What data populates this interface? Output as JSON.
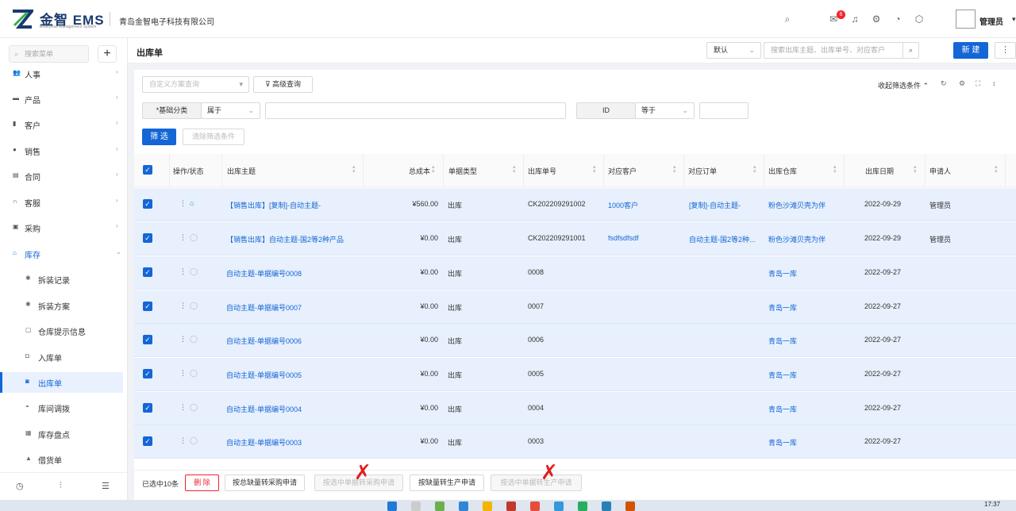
{
  "header": {
    "logo_text": "金智 EMS",
    "logo_sub": "Enterprise Management System",
    "company": "青岛金智电子科技有限公司",
    "badge_count": "6",
    "user_name": "管理员"
  },
  "sidebar": {
    "search_placeholder": "搜索菜单",
    "plus": "+",
    "items": [
      {
        "label": "人事",
        "icon": "people-icon"
      },
      {
        "label": "产品",
        "icon": "product-icon"
      },
      {
        "label": "客户",
        "icon": "customer-icon"
      },
      {
        "label": "销售",
        "icon": "sales-icon"
      },
      {
        "label": "合同",
        "icon": "contract-icon"
      },
      {
        "label": "客服",
        "icon": "headset-icon"
      },
      {
        "label": "采购",
        "icon": "purchase-icon"
      },
      {
        "label": "库存",
        "icon": "warehouse-icon"
      }
    ],
    "sub_items": [
      {
        "label": "拆装记录"
      },
      {
        "label": "拆装方案"
      },
      {
        "label": "仓库提示信息"
      },
      {
        "label": "入库单"
      },
      {
        "label": "出库单"
      },
      {
        "label": "库间调拨"
      },
      {
        "label": "库存盘点"
      },
      {
        "label": "借货单"
      }
    ]
  },
  "page": {
    "title": "出库单",
    "view_select": "默认",
    "search_placeholder": "搜索出库主题、出库单号、对应客户",
    "new_label": "新 建"
  },
  "filters": {
    "custom_placeholder": "自定义方案查询",
    "advanced_label": "高级查询",
    "collapse_label": "收起筛选条件",
    "field1_label": "*基础分类",
    "field1_op": "属于",
    "field2_label": "ID",
    "field2_op": "等于",
    "filter_btn": "筛 选",
    "clear_btn": "清除筛选条件"
  },
  "table": {
    "columns": [
      "操作/状态",
      "出库主题",
      "总成本",
      "单据类型",
      "出库单号",
      "对应客户",
      "对应订单",
      "出库仓库",
      "出库日期",
      "申请人"
    ],
    "rows": [
      {
        "subject": "【销售出库】[复制]-自动主题-",
        "cost": "¥560.00",
        "type": "出库",
        "number": "CK202209291002",
        "customer": "1000客户",
        "order": "[复制]-自动主题-",
        "warehouse": "粉色沙滩贝壳为伴",
        "date": "2022-09-29",
        "applicant": "管理员"
      },
      {
        "subject": "【销售出库】自动主题-国2等2种产品",
        "cost": "¥0.00",
        "type": "出库",
        "number": "CK202209291001",
        "customer": "fsdfsdfsdf",
        "order": "自动主题-国2等2种...",
        "warehouse": "粉色沙滩贝壳为伴",
        "date": "2022-09-29",
        "applicant": "管理员"
      },
      {
        "subject": "自动主题-单据编号0008",
        "cost": "¥0.00",
        "type": "出库",
        "number": "0008",
        "customer": "",
        "order": "",
        "warehouse": "青岛一库",
        "date": "2022-09-27",
        "applicant": ""
      },
      {
        "subject": "自动主题-单据编号0007",
        "cost": "¥0.00",
        "type": "出库",
        "number": "0007",
        "customer": "",
        "order": "",
        "warehouse": "青岛一库",
        "date": "2022-09-27",
        "applicant": ""
      },
      {
        "subject": "自动主题-单据编号0006",
        "cost": "¥0.00",
        "type": "出库",
        "number": "0006",
        "customer": "",
        "order": "",
        "warehouse": "青岛一库",
        "date": "2022-09-27",
        "applicant": ""
      },
      {
        "subject": "自动主题-单据编号0005",
        "cost": "¥0.00",
        "type": "出库",
        "number": "0005",
        "customer": "",
        "order": "",
        "warehouse": "青岛一库",
        "date": "2022-09-27",
        "applicant": ""
      },
      {
        "subject": "自动主题-单据编号0004",
        "cost": "¥0.00",
        "type": "出库",
        "number": "0004",
        "customer": "",
        "order": "",
        "warehouse": "青岛一库",
        "date": "2022-09-27",
        "applicant": ""
      },
      {
        "subject": "自动主题-单据编号0003",
        "cost": "¥0.00",
        "type": "出库",
        "number": "0003",
        "customer": "",
        "order": "",
        "warehouse": "青岛一库",
        "date": "2022-09-27",
        "applicant": ""
      }
    ]
  },
  "footer": {
    "selected": "已选中10条",
    "delete": "删 除",
    "btn1": "按总缺量转采购申请",
    "btn2": "按选中单据转采购申请",
    "btn3": "按缺量转生产申请",
    "btn4": "按选中单据转生产申请"
  },
  "taskbar": {
    "time": "17:37"
  },
  "colors": {
    "primary": "#1466d6",
    "danger": "#f5222d",
    "row_selected": "#e7f0fc"
  }
}
